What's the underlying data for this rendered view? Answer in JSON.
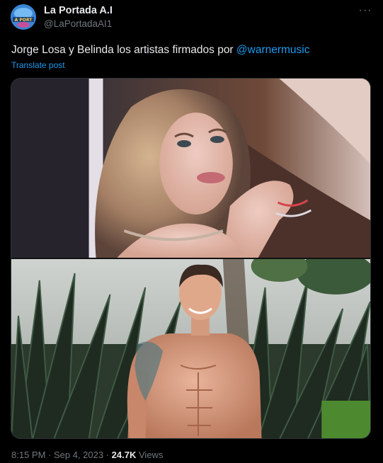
{
  "author": {
    "display_name": "La Portada A.I",
    "handle": "@LaPortadaAI1",
    "avatar_text": "A PORT"
  },
  "menu": {
    "more_label": "···"
  },
  "tweet": {
    "text_prefix": "Jorge Losa y Belinda los artistas firmados por ",
    "mention": "@warnermusic",
    "translate_label": "Translate post"
  },
  "media": {
    "photos": [
      {
        "alt": "photo-woman-portrait"
      },
      {
        "alt": "photo-man-shirtless-plants"
      }
    ]
  },
  "meta": {
    "time": "8:15 PM",
    "separator": " · ",
    "date": "Sep 4, 2023",
    "views_count": "24.7K",
    "views_label": "Views"
  },
  "colors": {
    "background": "#000000",
    "text": "#e7e9ea",
    "secondary_text": "#71767b",
    "link": "#1d9bf0"
  }
}
